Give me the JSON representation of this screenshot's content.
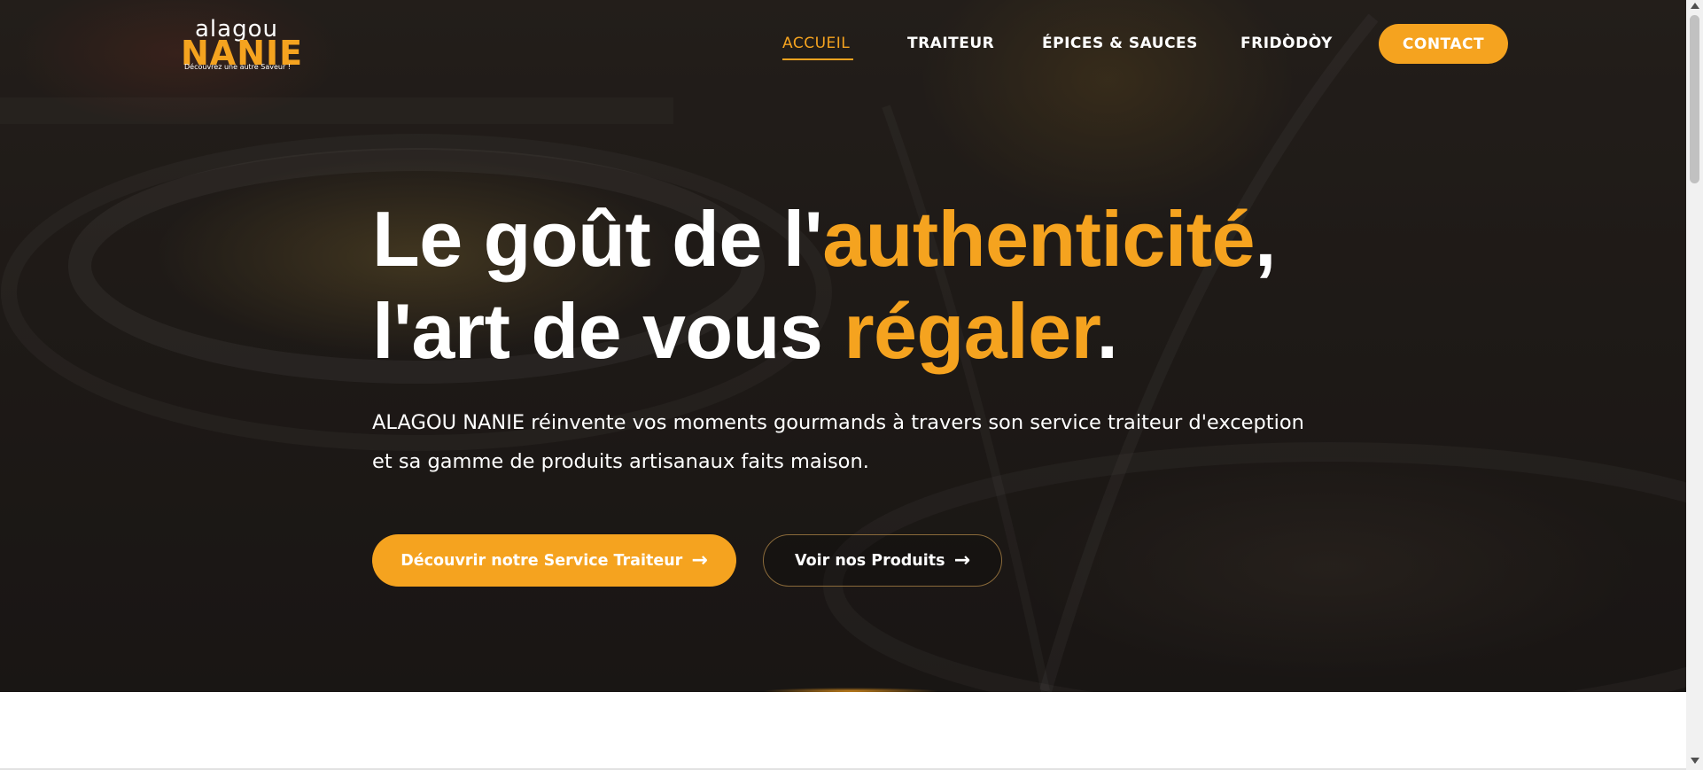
{
  "brand": {
    "logo_top": "alagou",
    "logo_main": "NANIE",
    "tagline": "Découvrez une autre Saveur !",
    "accent_color": "#f5a31f"
  },
  "nav": {
    "items": [
      {
        "label": "ACCUEIL",
        "active": true
      },
      {
        "label": "TRAITEUR",
        "active": false
      },
      {
        "label": "ÉPICES & SAUCES",
        "active": false
      },
      {
        "label": "FRIDÒDÒY",
        "active": false
      }
    ],
    "contact_label": "CONTACT"
  },
  "hero": {
    "headline_part1": "Le goût de l'",
    "headline_accent1": "authenticité",
    "headline_part2": ",",
    "headline_part3": "l'art de vous ",
    "headline_accent2": "régaler",
    "headline_part4": ".",
    "subtitle_line1": "ALAGOU NANIE réinvente vos moments gourmands à travers son service traiteur d'exception",
    "subtitle_line2": "et sa gamme de produits artisanaux faits maison.",
    "primary_cta": "Découvrir notre Service Traiteur",
    "secondary_cta": "Voir nos Produits",
    "arrow": "→"
  },
  "icons": {
    "arrow": "arrow-right-icon",
    "scroll_up": "chevron-up-icon",
    "scroll_down": "chevron-down-icon"
  }
}
